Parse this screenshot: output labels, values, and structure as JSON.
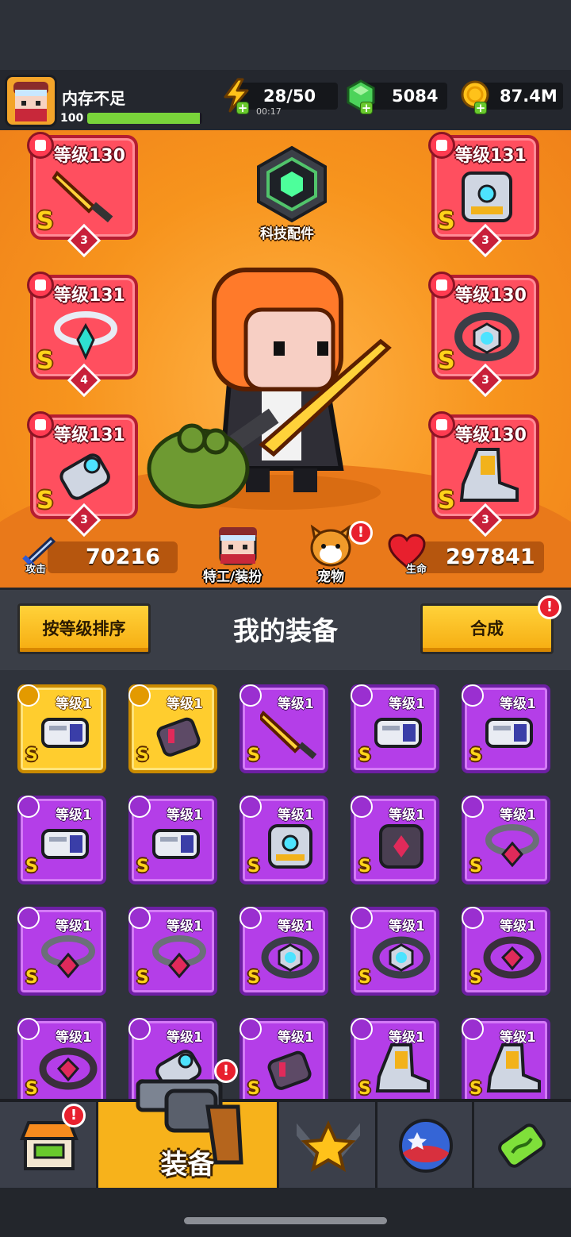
{
  "player": {
    "name": "内存不足",
    "level": "100",
    "xp_progress": 0.98
  },
  "resources": {
    "energy": {
      "value": "28/50",
      "timer": "00:17",
      "icon": "lightning-icon"
    },
    "gems": {
      "value": "5084",
      "icon": "gem-icon"
    },
    "coins": {
      "value": "87.4M",
      "icon": "coin-icon"
    }
  },
  "tech": {
    "label": "科技配件",
    "icon": "hexagon-tech-icon"
  },
  "equipped": [
    {
      "slot": "weapon",
      "level": "等级130",
      "grade": "S",
      "stars": "3",
      "icon": "sword-icon"
    },
    {
      "slot": "armor",
      "level": "等级131",
      "grade": "S",
      "stars": "3",
      "icon": "armor-icon"
    },
    {
      "slot": "necklace",
      "level": "等级131",
      "grade": "S",
      "stars": "4",
      "icon": "necklace-icon"
    },
    {
      "slot": "belt",
      "level": "等级130",
      "grade": "S",
      "stars": "3",
      "icon": "belt-icon"
    },
    {
      "slot": "glove",
      "level": "等级131",
      "grade": "S",
      "stars": "3",
      "icon": "gauntlet-icon"
    },
    {
      "slot": "boots",
      "level": "等级130",
      "grade": "S",
      "stars": "3",
      "icon": "boots-icon"
    }
  ],
  "stats": {
    "attack": {
      "label": "攻击",
      "value": "70216",
      "icon": "sword-stat-icon"
    },
    "health": {
      "label": "生命",
      "value": "297841",
      "icon": "heart-icon"
    }
  },
  "agent_button": {
    "label": "特工/装扮"
  },
  "pet_button": {
    "label": "宠物",
    "badge": "!"
  },
  "toolbar": {
    "sort_label": "按等级排序",
    "title": "我的装备",
    "merge_label": "合成",
    "merge_badge": "!"
  },
  "inventory": [
    {
      "level": "等级1",
      "grade": "S",
      "rarity": "gold",
      "icon": "blaster-icon"
    },
    {
      "level": "等级1",
      "grade": "S",
      "rarity": "gold",
      "icon": "claw-glove-icon"
    },
    {
      "level": "等级1",
      "grade": "S",
      "rarity": "purple",
      "icon": "sword-icon"
    },
    {
      "level": "等级1",
      "grade": "S",
      "rarity": "purple",
      "icon": "blaster-icon"
    },
    {
      "level": "等级1",
      "grade": "S",
      "rarity": "purple",
      "icon": "blaster-icon"
    },
    {
      "level": "等级1",
      "grade": "S",
      "rarity": "purple",
      "icon": "blaster-icon"
    },
    {
      "level": "等级1",
      "grade": "S",
      "rarity": "purple",
      "icon": "blaster-icon"
    },
    {
      "level": "等级1",
      "grade": "S",
      "rarity": "purple",
      "icon": "armor-icon"
    },
    {
      "level": "等级1",
      "grade": "S",
      "rarity": "purple",
      "icon": "dark-armor-icon"
    },
    {
      "level": "等级1",
      "grade": "S",
      "rarity": "purple",
      "icon": "chain-necklace-icon"
    },
    {
      "level": "等级1",
      "grade": "S",
      "rarity": "purple",
      "icon": "chain-necklace-icon"
    },
    {
      "level": "等级1",
      "grade": "S",
      "rarity": "purple",
      "icon": "chain-necklace-icon"
    },
    {
      "level": "等级1",
      "grade": "S",
      "rarity": "purple",
      "icon": "belt-icon"
    },
    {
      "level": "等级1",
      "grade": "S",
      "rarity": "purple",
      "icon": "belt-icon"
    },
    {
      "level": "等级1",
      "grade": "S",
      "rarity": "purple",
      "icon": "dark-belt-icon"
    },
    {
      "level": "等级1",
      "grade": "S",
      "rarity": "purple",
      "icon": "dark-belt-icon"
    },
    {
      "level": "等级1",
      "grade": "S",
      "rarity": "purple",
      "icon": "gauntlet-icon"
    },
    {
      "level": "等级1",
      "grade": "S",
      "rarity": "purple",
      "icon": "claw-glove-icon"
    },
    {
      "level": "等级1",
      "grade": "S",
      "rarity": "purple",
      "icon": "boots-icon"
    },
    {
      "level": "等级1",
      "grade": "S",
      "rarity": "purple",
      "icon": "boots-icon"
    }
  ],
  "nav": {
    "shop": {
      "icon": "shop-icon",
      "badge": "!"
    },
    "equipment": {
      "label": "装备",
      "icon": "revolver-icon",
      "badge": "!"
    },
    "skills": {
      "icon": "star-swords-icon"
    },
    "world": {
      "icon": "planet-icon"
    },
    "lab": {
      "icon": "dna-capsule-icon"
    }
  },
  "colors": {
    "accent": "#f7b21b",
    "equipped_card": "#ff4f5f",
    "epic": "#b43ee8",
    "legendary": "#ffcd2e"
  }
}
